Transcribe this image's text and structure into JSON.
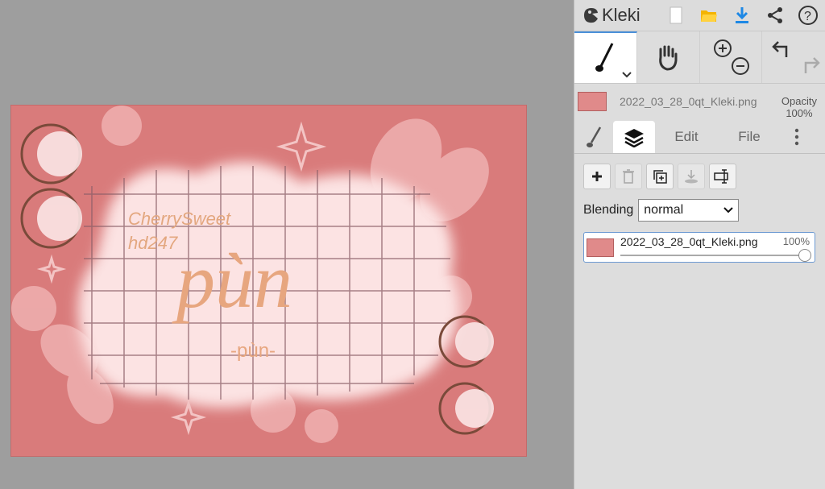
{
  "app": {
    "title": "Kleki"
  },
  "file": {
    "name": "2022_03_28_0qt_Kleki.png",
    "opacity_label": "Opacity",
    "opacity_value": "100%"
  },
  "tabs": [
    {
      "label": "",
      "icon": "brush-icon"
    },
    {
      "label": "",
      "icon": "layers-icon"
    },
    {
      "label": "Edit"
    },
    {
      "label": "File"
    }
  ],
  "blending": {
    "label": "Blending",
    "value": "normal"
  },
  "layers": [
    {
      "name": "2022_03_28_0qt_Kleki.png",
      "opacity": "100%",
      "opacity_fraction": 1.0
    }
  ],
  "artwork": {
    "text_small_1": "CherrySweet",
    "text_small_2": "hd247",
    "text_big": "pùn",
    "text_sub": "-pùn-"
  },
  "colors": {
    "accent": "#4a90d9",
    "canvas_bg": "#d97b7b",
    "panel_bg": "#dddddd"
  }
}
